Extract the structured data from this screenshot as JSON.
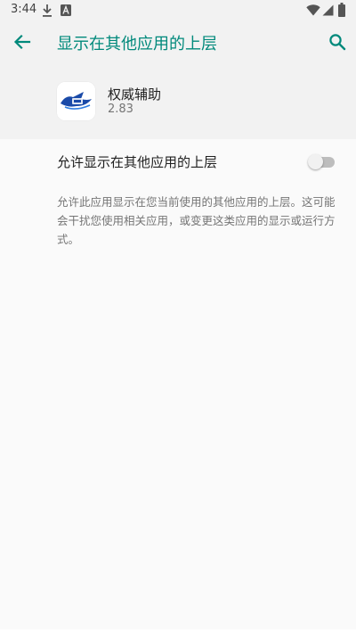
{
  "status_bar": {
    "time": "3:44",
    "left_icons": [
      "download-icon",
      "font-a-icon"
    ],
    "right_icons": [
      "wifi-icon",
      "signal-icon",
      "battery-icon"
    ]
  },
  "app_bar": {
    "title": "显示在其他应用的上层",
    "back_icon": "arrow-back-icon",
    "search_icon": "search-icon",
    "accent_color": "#00897b"
  },
  "app_info": {
    "name": "权威辅助",
    "version": "2.83",
    "icon": "app-logo-icon"
  },
  "setting": {
    "label": "允许显示在其他应用的上层",
    "enabled": false
  },
  "description": "允许此应用显示在您当前使用的其他应用的上层。这可能会干扰您使用相关应用，或变更这类应用的显示或运行方式。"
}
